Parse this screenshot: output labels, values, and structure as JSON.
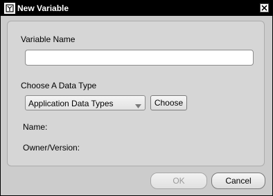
{
  "window": {
    "title": "New Variable",
    "icon": "app-logo-icon",
    "close_icon": "close-icon"
  },
  "form": {
    "variable_name_label": "Variable Name",
    "variable_name_value": "",
    "data_type_label": "Choose A Data Type",
    "data_type_selected": "Application Data Types",
    "choose_button": "Choose",
    "name_label": "Name:",
    "owner_version_label": "Owner/Version:"
  },
  "footer": {
    "ok_button": "OK",
    "cancel_button": "Cancel"
  }
}
